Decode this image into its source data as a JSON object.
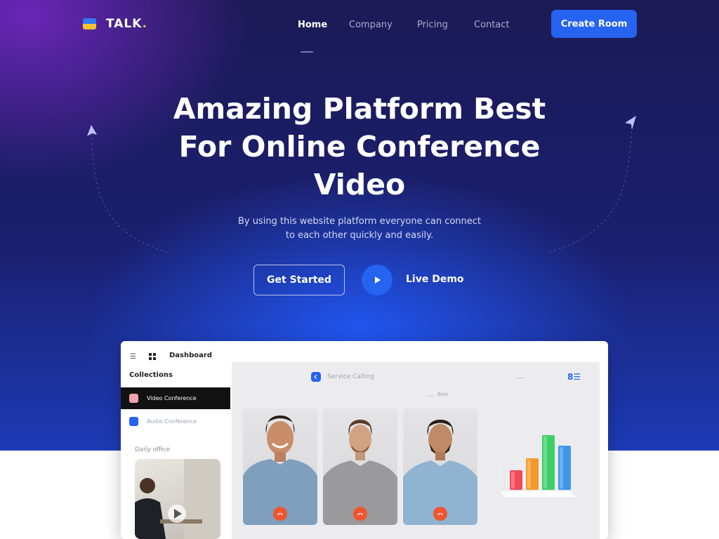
{
  "brand": {
    "name": "TALK",
    "dot": "."
  },
  "nav": {
    "items": [
      {
        "label": "Home",
        "active": true
      },
      {
        "label": "Company",
        "active": false
      },
      {
        "label": "Pricing",
        "active": false
      },
      {
        "label": "Contact",
        "active": false
      }
    ],
    "cta": "Create Room"
  },
  "hero": {
    "headline": [
      "Amazing Platform Best",
      "For Online Conference",
      "Video"
    ],
    "subtext": [
      "By using this website platform everyone can connect",
      "to each other quickly and easily."
    ],
    "primary_button": "Get Started",
    "secondary_button": "Live Demo"
  },
  "dashboard": {
    "title": "Dashboard",
    "collections_label": "Collections",
    "sidebar_items": [
      {
        "label": "Video Conference",
        "active": true,
        "color": "#f3a0b0"
      },
      {
        "label": "Audio Conference",
        "active": false,
        "color": "#2563f0"
      }
    ],
    "daily_label": "Daily office",
    "service_label": "Service Calling",
    "best_label": "Best",
    "participants": [
      {
        "shirt": "#7f9fbd"
      },
      {
        "shirt": "#9a9a9c"
      },
      {
        "shirt": "#8fb3d0"
      }
    ],
    "bars": [
      {
        "color": "#ef4b5a",
        "level": 0.28
      },
      {
        "color": "#f39a2b",
        "level": 0.45
      },
      {
        "color": "#3fcf6a",
        "level": 0.78
      },
      {
        "color": "#3d97e8",
        "level": 0.63
      }
    ]
  },
  "colors": {
    "accent": "#2563f0",
    "end_call": "#f2542d"
  }
}
